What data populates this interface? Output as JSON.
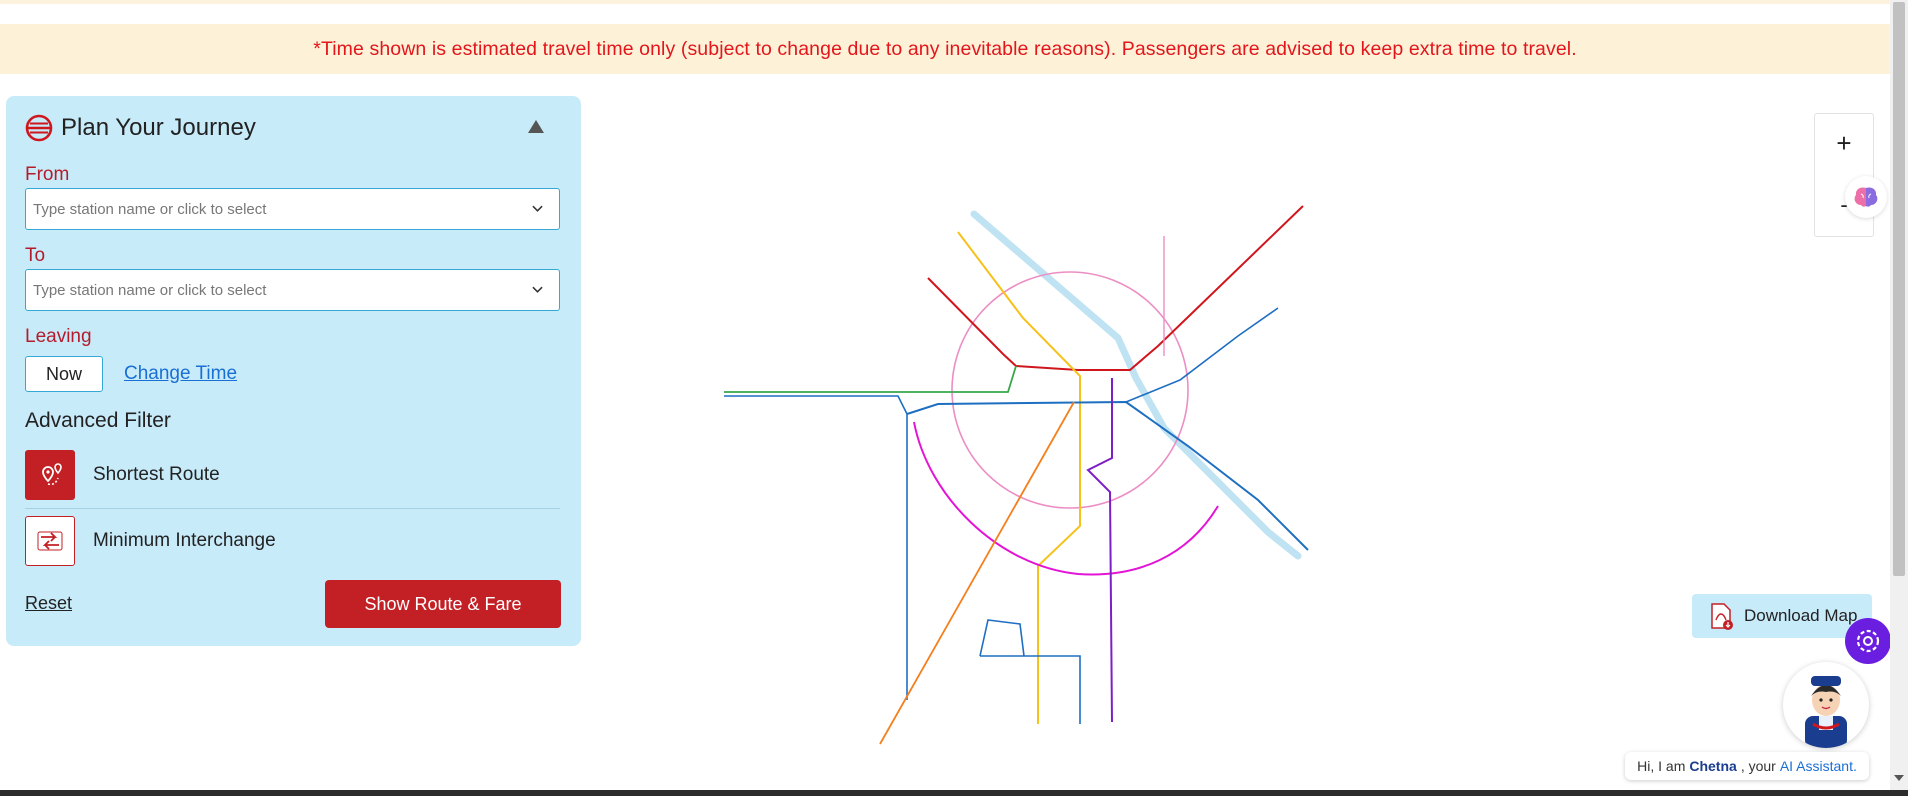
{
  "notice": "*Time shown is estimated travel time only (subject to change due to any inevitable reasons). Passengers are advised to keep extra time to travel.",
  "planner": {
    "title": "Plan Your Journey",
    "from_label": "From",
    "from_placeholder": "Type station name or click to select",
    "to_label": "To",
    "to_placeholder": "Type station name or click to select",
    "leaving_label": "Leaving",
    "now_label": "Now",
    "change_time_label": "Change Time",
    "advanced_filter_label": "Advanced Filter",
    "filters": [
      {
        "label": "Shortest Route",
        "icon": "route-pin-icon",
        "selected": true
      },
      {
        "label": "Minimum Interchange",
        "icon": "interchange-arrows-icon",
        "selected": false
      }
    ],
    "reset_label": "Reset",
    "submit_label": "Show Route & Fare"
  },
  "map": {
    "zoom_in": "+",
    "zoom_out": "-",
    "download_label": "Download Map",
    "line_colors": {
      "red": "#d0161d",
      "yellow": "#f6c11a",
      "blue": "#1e6fc1",
      "green": "#38a849",
      "violet": "#7d1ec7",
      "pink": "#ec8ec4",
      "magenta": "#e414d6",
      "orange": "#f4801d",
      "grey": "#8f8f8f",
      "river": "#bfe3f2"
    }
  },
  "assistant": {
    "greeting_prefix": "Hi, I am",
    "name": "Chetna",
    "greeting_mid": ", your",
    "role": "AI Assistant."
  },
  "colors": {
    "notice_bg": "#fdf1d8",
    "notice_text": "#e3161b",
    "panel_bg": "#c8ebfa",
    "label_red": "#b51c2b",
    "button_red": "#c32026",
    "link_blue": "#1a6fd4",
    "gear_purple": "#6a1ee0"
  }
}
